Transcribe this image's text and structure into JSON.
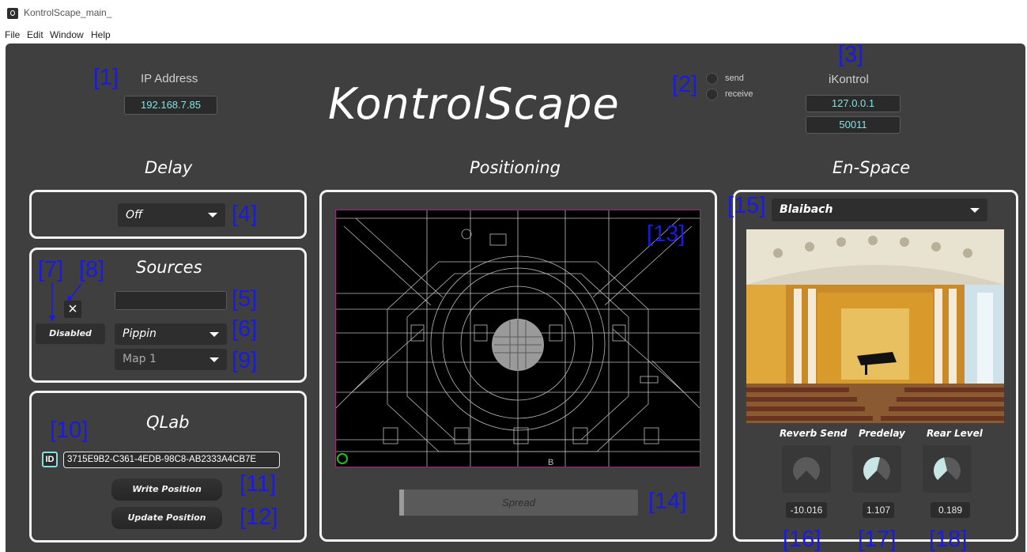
{
  "window": {
    "title": "KontrolScape_main_"
  },
  "menu": [
    "File",
    "Edit",
    "Window",
    "Help"
  ],
  "header": {
    "logo": "KontrolScape",
    "ip_label": "IP Address",
    "ip_value": "192.168.7.85",
    "send_label": "send",
    "receive_label": "receive",
    "ikontrol_label": "iKontrol",
    "ikontrol_ip": "127.0.0.1",
    "ikontrol_port": "50011"
  },
  "sections": {
    "delay": "Delay",
    "positioning": "Positioning",
    "enspace": "En-Space"
  },
  "delay": {
    "selected": "Off"
  },
  "sources": {
    "title": "Sources",
    "name_value": "",
    "close_glyph": "×",
    "disabled_label": "Disabled",
    "source_selected": "Pippin",
    "map_selected": "Map 1"
  },
  "qlab": {
    "title": "QLab",
    "id_label": "ID",
    "id_value": "3715E9B2-C361-4EDB-98C8-AB2333A4CB7E",
    "write_label": "Write Position",
    "update_label": "Update Position"
  },
  "positioning": {
    "spread_label": "Spread",
    "plan_marker": "B"
  },
  "enspace": {
    "space_selected": "Blaibach",
    "knobs": [
      {
        "label": "Reverb Send",
        "value": "-10.016",
        "fill_fraction": 0.0
      },
      {
        "label": "Predelay",
        "value": "1.107",
        "fill_fraction": 0.55
      },
      {
        "label": "Rear Level",
        "value": "0.189",
        "fill_fraction": 0.45
      }
    ]
  },
  "annotations": [
    "[1]",
    "[2]",
    "[3]",
    "[4]",
    "[5]",
    "[6]",
    "[7]",
    "[8]",
    "[9]",
    "[10]",
    "[11]",
    "[12]",
    "[13]",
    "[14]",
    "[15]",
    "[16]",
    "[17]",
    "[18]"
  ],
  "icons": {
    "app": "app-icon",
    "close": "close-icon",
    "dropdown": "chevron-down-icon"
  },
  "colors": {
    "panel": "#3f3f3f",
    "field_text": "#7fe3e3",
    "annotation": "#1a1ae6",
    "knob_fill": "#c8e6e6"
  }
}
